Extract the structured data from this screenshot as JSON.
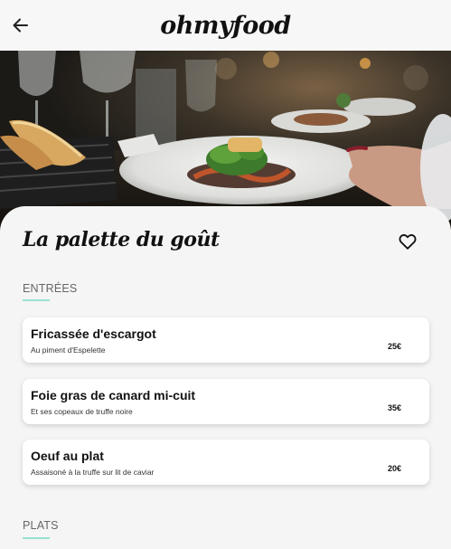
{
  "header": {
    "brand": "ohmyfood"
  },
  "restaurant": {
    "name": "La palette du goût"
  },
  "sections": [
    {
      "label": "ENTRÉES",
      "items": [
        {
          "name": "Fricassée d'escargot",
          "description": "Au piment d'Espelette",
          "price": "25€"
        },
        {
          "name": "Foie gras de canard mi-cuit",
          "description": "Et ses copeaux de truffe noire",
          "price": "35€"
        },
        {
          "name": "Oeuf au plat",
          "description": "Assaisoné à la truffe sur lit de caviar",
          "price": "20€"
        }
      ]
    },
    {
      "label": "PLATS",
      "items": []
    }
  ],
  "icons": {
    "back": "arrow-left-icon",
    "favorite": "heart-outline-icon"
  },
  "colors": {
    "accent": "#99e2d0",
    "background": "#f5f5f5",
    "text": "#111111"
  }
}
